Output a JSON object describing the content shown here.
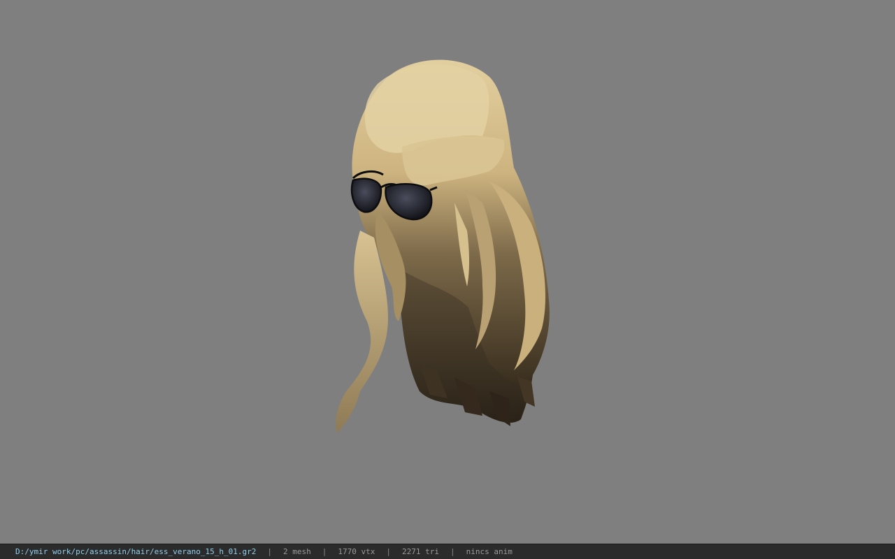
{
  "viewport": {
    "background": "#7f7f7f",
    "model": "hair-with-sunglasses"
  },
  "status_bar": {
    "file_path": "D:/ymir work/pc/assassin/hair/ess_verano_15_h_01.gr2",
    "mesh": "2 mesh",
    "vertices": "1770 vtx",
    "triangles": "2271 tri",
    "anim": "nincs anim",
    "separator": "|"
  },
  "colors": {
    "path": "#8fd0ef",
    "stats": "#9a9a9a",
    "status_bg": "#2b2b2b",
    "hair_light": "#dcc795",
    "hair_dark": "#3a2f1f"
  }
}
